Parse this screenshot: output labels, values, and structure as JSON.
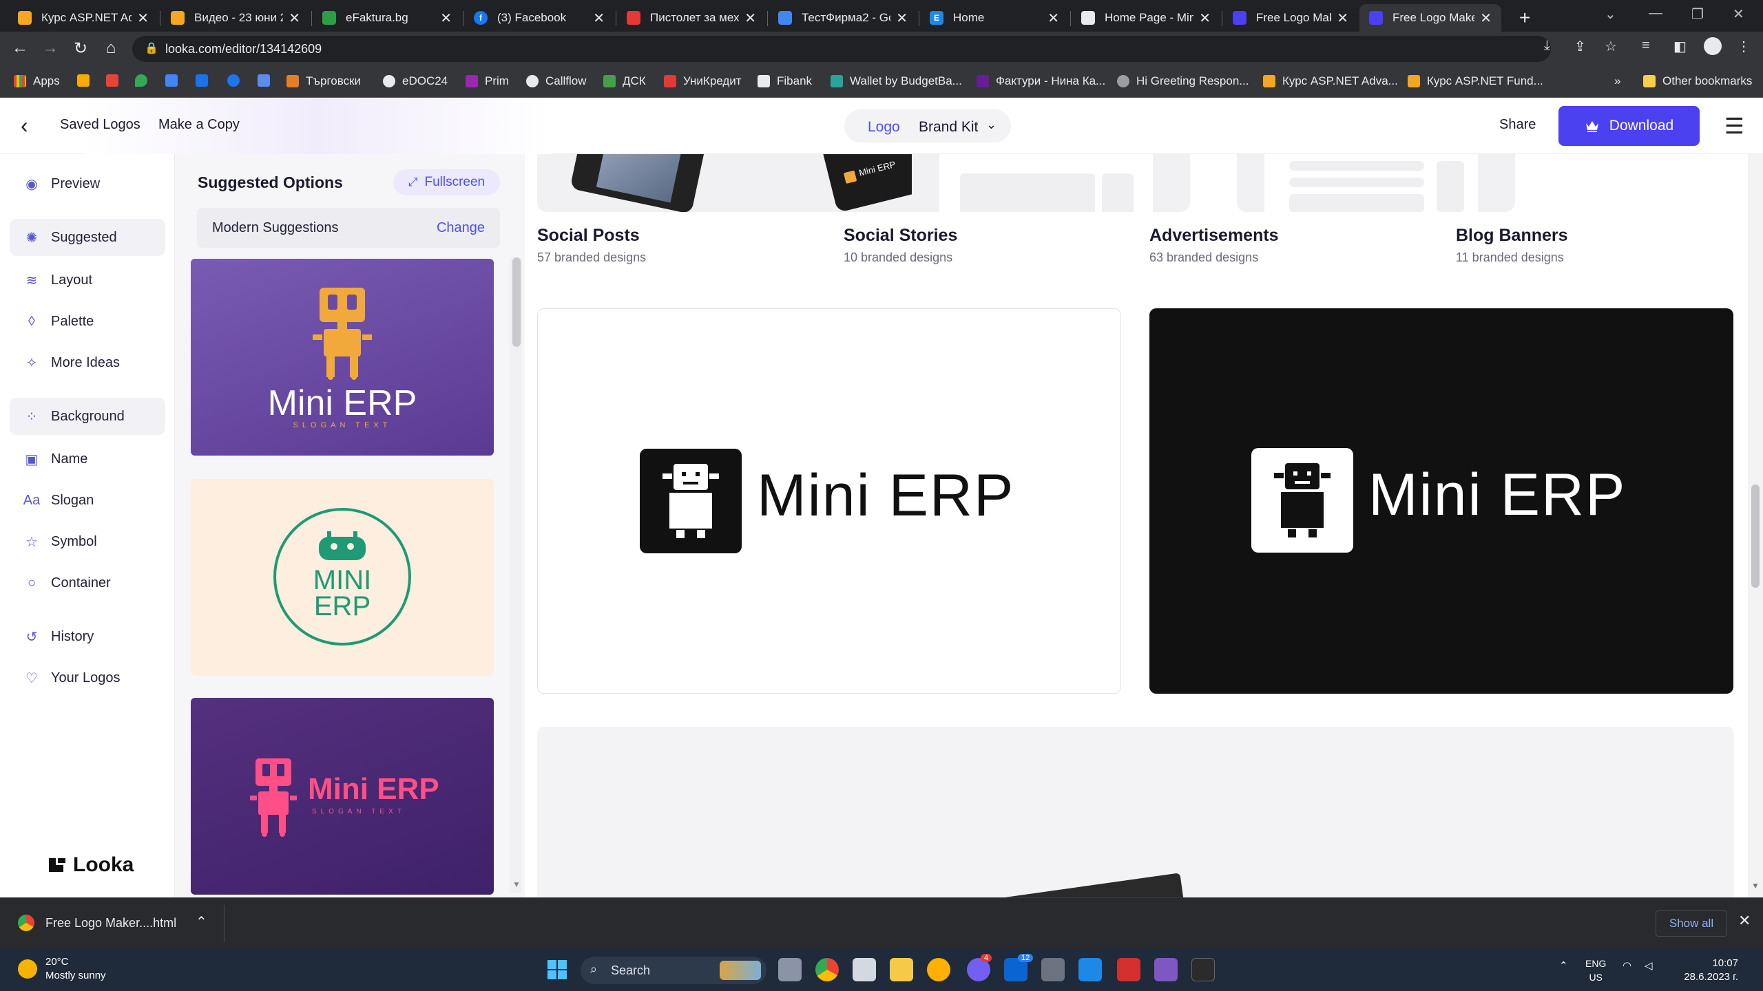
{
  "browser": {
    "tabs": [
      {
        "title": "Курс ASP.NET Ad",
        "color": "#f5a623"
      },
      {
        "title": "Видео - 23 юни 2",
        "color": "#f5a623"
      },
      {
        "title": "eFaktura.bg",
        "color": "#2e9e44"
      },
      {
        "title": "(3) Facebook",
        "color": "#1877f2"
      },
      {
        "title": "Пистолет за мех",
        "color": "#e53935"
      },
      {
        "title": "ТестФирма2 - Go",
        "color": "#4285f4"
      },
      {
        "title": "Home",
        "color": "#1e88e5"
      },
      {
        "title": "Home Page - Min",
        "color": "#e8eaed"
      },
      {
        "title": "Free Logo Maker",
        "color": "#4b41f0"
      },
      {
        "title": "Free Logo Maker",
        "color": "#4b41f0"
      }
    ],
    "url": "looka.com/editor/134142609",
    "bookmarks": [
      "Apps",
      "Търговски",
      "eDOC24",
      "Prim",
      "Callflow",
      "ДСК",
      "УниКредит",
      "Fibank",
      "Wallet by BudgetBa...",
      "Фактури - Нина Ка...",
      "Hi Greeting Respon...",
      "Курс ASP.NET Adva...",
      "Курс ASP.NET Fund..."
    ],
    "other_bookmarks": "Other bookmarks",
    "more_bookmarks": "»"
  },
  "header": {
    "saved_logos": "Saved Logos",
    "make_copy": "Make a Copy",
    "tab_logo": "Logo",
    "tab_brand_kit": "Brand Kit",
    "share": "Share",
    "download": "Download"
  },
  "sidebar": {
    "items": [
      {
        "label": "Preview",
        "icon": "eye-icon"
      },
      {
        "label": "Suggested",
        "icon": "bulb-icon"
      },
      {
        "label": "Layout",
        "icon": "layers-icon"
      },
      {
        "label": "Palette",
        "icon": "drop-icon"
      },
      {
        "label": "More Ideas",
        "icon": "magic-icon"
      },
      {
        "label": "Background",
        "icon": "grid-icon"
      },
      {
        "label": "Name",
        "icon": "text-box-icon"
      },
      {
        "label": "Slogan",
        "icon": "font-icon"
      },
      {
        "label": "Symbol",
        "icon": "star-icon"
      },
      {
        "label": "Container",
        "icon": "circle-icon"
      },
      {
        "label": "History",
        "icon": "history-icon"
      },
      {
        "label": "Your Logos",
        "icon": "heart-icon"
      }
    ],
    "brand": "Looka"
  },
  "suggestions": {
    "title": "Suggested Options",
    "fullscreen": "Fullscreen",
    "style_label": "Modern Suggestions",
    "change": "Change",
    "cards": [
      {
        "name": "Mini ERP",
        "slogan": "SLOGAN TEXT",
        "bg": "#6a4ba3",
        "fg": "#f2a93b"
      },
      {
        "name_line1": "MINI",
        "name_line2": "ERP",
        "bg": "#fdeee0",
        "fg": "#1e9a74"
      },
      {
        "name": "Mini ERP",
        "slogan": "SLOGAN TEXT",
        "bg": "#4a2a78",
        "fg": "#ff4f86"
      }
    ]
  },
  "main": {
    "categories": [
      {
        "title": "Social Posts",
        "subtitle": "57 branded designs"
      },
      {
        "title": "Social Stories",
        "subtitle": "10 branded designs"
      },
      {
        "title": "Advertisements",
        "subtitle": "63 branded designs"
      },
      {
        "title": "Blog Banners",
        "subtitle": "11 branded designs"
      }
    ],
    "story_phone_label": "Mini ERP",
    "logo_light_text": "Mini ERP",
    "logo_dark_text": "Mini ERP"
  },
  "download_shelf": {
    "file": "Free Logo Maker....html",
    "show_all": "Show all"
  },
  "taskbar": {
    "temperature": "20°C",
    "weather": "Mostly sunny",
    "search": "Search",
    "lang_top": "ENG",
    "lang_bottom": "US",
    "time": "10:07",
    "date": "28.6.2023 г.",
    "badge_viber": "4",
    "badge_outlook": "12"
  }
}
